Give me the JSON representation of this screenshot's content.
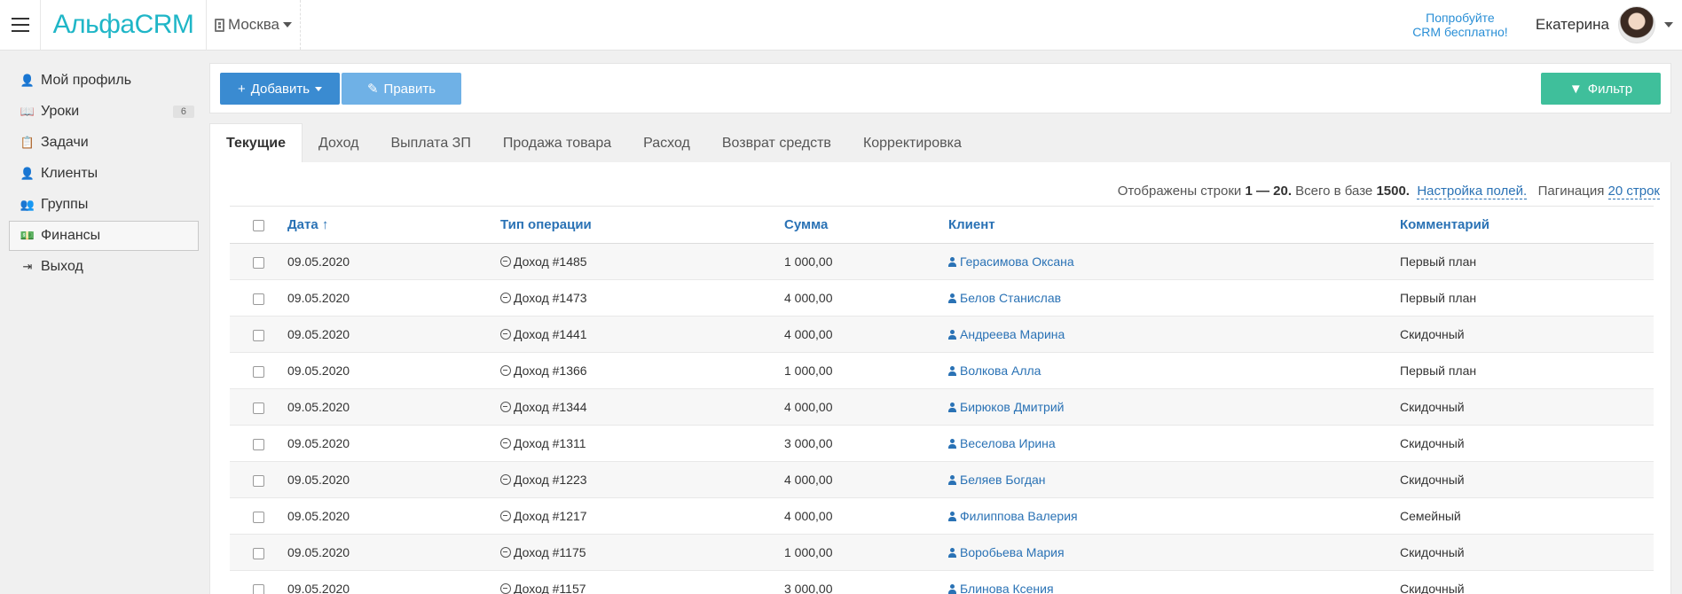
{
  "header": {
    "logo": "АльфаCRM",
    "city": "Москва",
    "promo_line1": "Попробуйте",
    "promo_line2": "CRM бесплатно!",
    "user_name": "Екатерина"
  },
  "sidebar": {
    "items": [
      {
        "label": "Мой профиль",
        "icon": "user-icon"
      },
      {
        "label": "Уроки",
        "icon": "book-icon",
        "badge": "6"
      },
      {
        "label": "Задачи",
        "icon": "clipboard-icon"
      },
      {
        "label": "Клиенты",
        "icon": "user-icon"
      },
      {
        "label": "Группы",
        "icon": "users-icon"
      },
      {
        "label": "Финансы",
        "icon": "money-icon",
        "active": true
      },
      {
        "label": "Выход",
        "icon": "logout-icon"
      }
    ]
  },
  "toolbar": {
    "add_label": "Добавить",
    "edit_label": "Править",
    "filter_label": "Фильтр"
  },
  "tabs": [
    {
      "label": "Текущие",
      "active": true
    },
    {
      "label": "Доход"
    },
    {
      "label": "Выплата ЗП"
    },
    {
      "label": "Продажа товара"
    },
    {
      "label": "Расход"
    },
    {
      "label": "Возврат средств"
    },
    {
      "label": "Корректировка"
    }
  ],
  "info": {
    "prefix": "Отображены строки",
    "range": "1 — 20.",
    "total_prefix": "Всего в базе",
    "total": "1500.",
    "fields_link": "Настройка полей.",
    "pagination_label": "Пагинация",
    "pagination_value": "20 строк"
  },
  "table": {
    "headers": {
      "date": "Дата",
      "sort_arrow": "↑",
      "type": "Тип операции",
      "sum": "Сумма",
      "client": "Клиент",
      "comment": "Комментарий"
    },
    "rows": [
      {
        "date": "09.05.2020",
        "type": "Доход #1485",
        "sum": "1 000,00",
        "client": "Герасимова Оксана",
        "comment": "Первый план"
      },
      {
        "date": "09.05.2020",
        "type": "Доход #1473",
        "sum": "4 000,00",
        "client": "Белов Станислав",
        "comment": "Первый план"
      },
      {
        "date": "09.05.2020",
        "type": "Доход #1441",
        "sum": "4 000,00",
        "client": "Андреева Марина",
        "comment": "Скидочный"
      },
      {
        "date": "09.05.2020",
        "type": "Доход #1366",
        "sum": "1 000,00",
        "client": "Волкова Алла",
        "comment": "Первый план"
      },
      {
        "date": "09.05.2020",
        "type": "Доход #1344",
        "sum": "4 000,00",
        "client": "Бирюков Дмитрий",
        "comment": "Скидочный"
      },
      {
        "date": "09.05.2020",
        "type": "Доход #1311",
        "sum": "3 000,00",
        "client": "Веселова Ирина",
        "comment": "Скидочный"
      },
      {
        "date": "09.05.2020",
        "type": "Доход #1223",
        "sum": "4 000,00",
        "client": "Беляев Богдан",
        "comment": "Скидочный"
      },
      {
        "date": "09.05.2020",
        "type": "Доход #1217",
        "sum": "4 000,00",
        "client": "Филиппова Валерия",
        "comment": "Семейный"
      },
      {
        "date": "09.05.2020",
        "type": "Доход #1175",
        "sum": "1 000,00",
        "client": "Воробьева Мария",
        "comment": "Скидочный"
      },
      {
        "date": "09.05.2020",
        "type": "Доход #1157",
        "sum": "3 000,00",
        "client": "Блинова Ксения",
        "comment": "Скидочный"
      }
    ]
  },
  "colors": {
    "brand": "#1fb6c7",
    "primary": "#3a8bd1",
    "primary_light": "#6fb1e6",
    "success": "#3fbf9b",
    "link": "#2a72b5"
  }
}
